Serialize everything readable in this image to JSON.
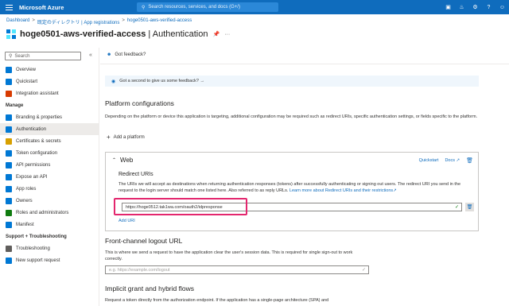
{
  "topbar": {
    "brand": "Microsoft Azure",
    "search_placeholder": "Search resources, services, and docs (G+/)",
    "icons": [
      "terminal-icon",
      "bell-icon",
      "settings-icon",
      "help-icon",
      "feedback-icon"
    ]
  },
  "breadcrumb": [
    "Dashboard",
    "既定のディレクトリ | App registrations",
    "hoge0501-aws-verified-access"
  ],
  "title": {
    "app_name": "hoge0501-aws-verified-access",
    "separator": " | ",
    "section": "Authentication"
  },
  "sidebar": {
    "search_placeholder": "Search",
    "items": [
      {
        "label": "Overview",
        "icon": "grid-icon",
        "color": "#0078d4"
      },
      {
        "label": "Quickstart",
        "icon": "cloud-icon",
        "color": "#0078d4"
      },
      {
        "label": "Integration assistant",
        "icon": "rocket-icon",
        "color": "#d83b01"
      }
    ],
    "manage_heading": "Manage",
    "manage_items": [
      {
        "label": "Branding & properties",
        "icon": "branding-icon",
        "color": "#0078d4"
      },
      {
        "label": "Authentication",
        "icon": "auth-icon",
        "color": "#0078d4",
        "active": true
      },
      {
        "label": "Certificates & secrets",
        "icon": "key-icon",
        "color": "#d8a000"
      },
      {
        "label": "Token configuration",
        "icon": "token-icon",
        "color": "#0078d4"
      },
      {
        "label": "API permissions",
        "icon": "api-icon",
        "color": "#0078d4"
      },
      {
        "label": "Expose an API",
        "icon": "cloud-expose-icon",
        "color": "#0078d4"
      },
      {
        "label": "App roles",
        "icon": "roles-icon",
        "color": "#0078d4"
      },
      {
        "label": "Owners",
        "icon": "owners-icon",
        "color": "#0078d4"
      },
      {
        "label": "Roles and administrators",
        "icon": "admin-icon",
        "color": "#107c10"
      },
      {
        "label": "Manifest",
        "icon": "manifest-icon",
        "color": "#0078d4"
      }
    ],
    "support_heading": "Support + Troubleshooting",
    "support_items": [
      {
        "label": "Troubleshooting",
        "icon": "wrench-icon",
        "color": "#605e5c"
      },
      {
        "label": "New support request",
        "icon": "support-icon",
        "color": "#0078d4"
      }
    ]
  },
  "main": {
    "feedback_label": "Got feedback?",
    "banner": "Got a second to give us some feedback? →",
    "platform_heading": "Platform configurations",
    "platform_desc": "Depending on the platform or device this application is targeting, additional configuration may be required such as redirect URIs, specific authentication settings, or fields specific to the platform.",
    "add_platform": "Add a platform",
    "web": {
      "title": "Web",
      "quickstart": "Quickstart",
      "docs": "Docs",
      "redirect_heading": "Redirect URIs",
      "redirect_desc": "The URIs we will accept as destinations when returning authentication responses (tokens) after successfully authenticating or signing out users. The redirect URI you send in the request to the login server should match one listed here. Also referred to as reply URLs.",
      "redirect_link": "Learn more about Redirect URIs and their restrictions",
      "redirect_uri": "https://hoge0512.tak1wa.com/oauth2/idpresponse",
      "add_uri": "Add URI"
    },
    "logout_heading": "Front-channel logout URL",
    "logout_desc": "This is where we send a request to have the application clear the user's session data. This is required for single sign-out to work correctly.",
    "logout_placeholder": "e.g. https://example.com/logout",
    "implicit_heading": "Implicit grant and hybrid flows",
    "implicit_desc": "Request a token directly from the authorization endpoint. If the application has a single-page architecture (SPA) and"
  }
}
